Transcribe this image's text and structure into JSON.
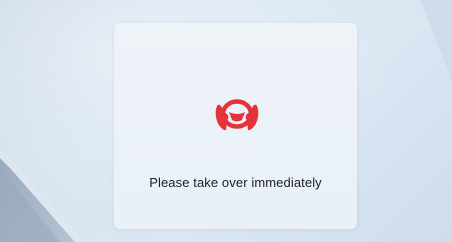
{
  "alert": {
    "icon": "hands-on-steering-wheel-icon",
    "icon_color": "#e5333a",
    "message": "Please take over immediately"
  }
}
